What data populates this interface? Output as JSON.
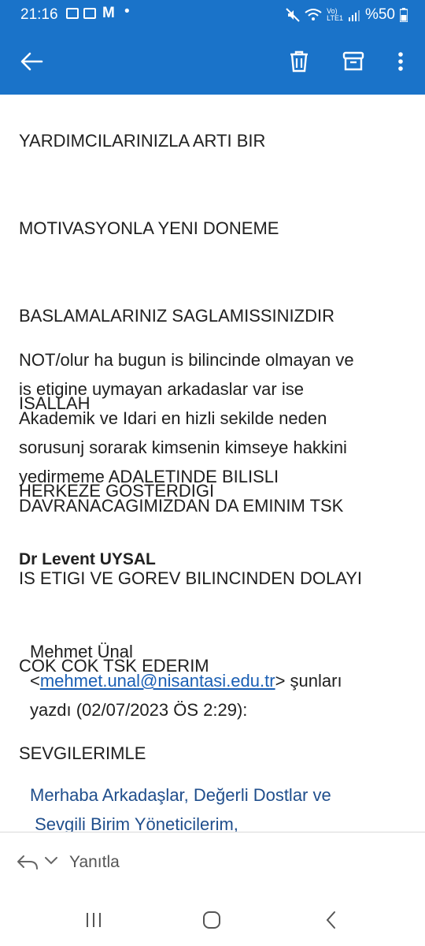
{
  "status_bar": {
    "time": "21:16",
    "battery": "%50",
    "icons": [
      "gallery-icon",
      "message-icon",
      "gmail-icon",
      "mute-icon",
      "wifi-icon",
      "volte-icon",
      "signal-icon",
      "battery-icon"
    ]
  },
  "toolbar": {
    "icons": [
      "back-arrow-icon",
      "delete-icon",
      "archive-icon",
      "more-vert-icon"
    ],
    "color": "#1a73c9"
  },
  "email": {
    "partial_line": "YARDIMCILARINIZLA ARTI BIR",
    "body_lines": [
      "MOTIVASYONLA YENI DONEME",
      "BASLAMALARINIZ SAGLAMISSINIZDIR",
      "ISALLAH",
      "HERKEZE GOSTERDIGI",
      "IS ETIGI VE GOREV BILINCINDEN DOLAYI",
      "COK COK TSK EDERIM",
      "SEVGILERIMLE"
    ],
    "note_lines": [
      "NOT/olur ha bugun is bilincinde olmayan ve",
      "is etigine uymayan arkadaslar var ise",
      "Akademik ve Idari  en hizli sekilde neden",
      "sorusunj sorarak kimsenin kimseye hakkini",
      "yedirmeme ADALETINDE BILISLI",
      "DAVRANACAGIMIZDAN DA EMINIM TSK"
    ],
    "signature": "Dr Levent UYSAL",
    "quote_header": {
      "sender": "Mehmet Ünal",
      "open_bracket": "<",
      "email": "mehmet.unal@nisantasi.edu.tr",
      "close_and_text": "> şunları",
      "date_line": "yazdı (02/07/2023 ÖS 2:29):"
    },
    "quoted_lines": [
      "Merhaba Arkadaşlar, Değerli Dostlar ve",
      " Sevgili Birim Yöneticilerim,"
    ]
  },
  "reply_bar": {
    "label": "Yanıtla"
  },
  "nav_bar": {
    "icons": [
      "recent-apps-icon",
      "home-icon",
      "back-icon"
    ]
  }
}
